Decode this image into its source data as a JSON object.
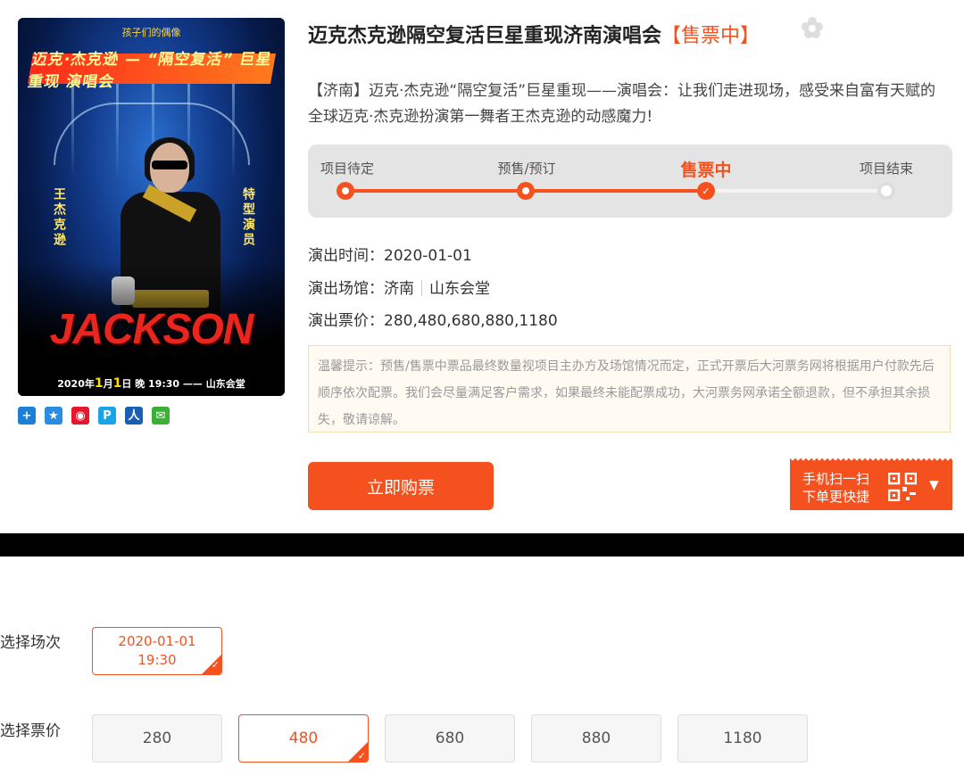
{
  "poster": {
    "top_text": "孩子们的偶像",
    "banner": "迈克·杰克逊 — “隔空复活” 巨星重现 演唱会",
    "side_left": "王杰克逊",
    "side_right": "特型演员",
    "brand": "JACKSON",
    "date_prefix": "2020年",
    "month": "1",
    "month_unit": "月",
    "day": "1",
    "day_unit": "日",
    "time": "晚 19:30",
    "venue": "—— 山东会堂"
  },
  "share_icons": [
    {
      "name": "share-plus-icon",
      "color": "#1e7fd6",
      "glyph": "+"
    },
    {
      "name": "share-qzone-icon",
      "color": "#2a8de0",
      "glyph": "★"
    },
    {
      "name": "share-weibo-icon",
      "color": "#e6162d",
      "glyph": "◉"
    },
    {
      "name": "share-tqq-icon",
      "color": "#1aa3e8",
      "glyph": "P"
    },
    {
      "name": "share-renren-icon",
      "color": "#1a5fb4",
      "glyph": "人"
    },
    {
      "name": "share-wechat-icon",
      "color": "#3cb034",
      "glyph": "✉"
    }
  ],
  "event": {
    "title": "迈克杰克逊隔空复活巨星重现济南演唱会",
    "status": "【售票中】",
    "description": "【济南】迈克·杰克逊“隔空复活”巨星重现——演唱会：让我们走进现场，感受来自富有天赋的全球迈克·杰克逊扮演第一舞者王杰克逊的动感魔力!"
  },
  "progress": {
    "steps": [
      "项目待定",
      "预售/预订",
      "售票中",
      "项目结束"
    ],
    "current_index": 2
  },
  "details": {
    "time_label": "演出时间：",
    "time_value": "2020-01-01",
    "venue_label": "演出场馆：",
    "venue_city": "济南",
    "venue_name": "山东会堂",
    "price_label": "演出票价：",
    "price_value": "280,480,680,880,1180"
  },
  "notice": "温馨提示：预售/售票中票品最终数量视项目主办方及场馆情况而定，正式开票后大河票务网将根据用户付款先后顺序依次配票。我们会尽量满足客户需求，如果最终未能配票成功，大河票务网承诺全额退款，但不承担其余损失，敬请谅解。",
  "buy_button": "立即购票",
  "scan_box": {
    "line1": "手机扫一扫",
    "line2": "下单更快捷"
  },
  "selection": {
    "session_label": "选择场次",
    "session_date": "2020-01-01",
    "session_time": "19:30",
    "price_label": "选择票价",
    "prices": [
      "280",
      "480",
      "680",
      "880",
      "1180"
    ],
    "selected_price": "480"
  },
  "colors": {
    "accent": "#f4511e",
    "progress_bg": "#e4e4e4",
    "notice_bg": "#fffbf2"
  }
}
